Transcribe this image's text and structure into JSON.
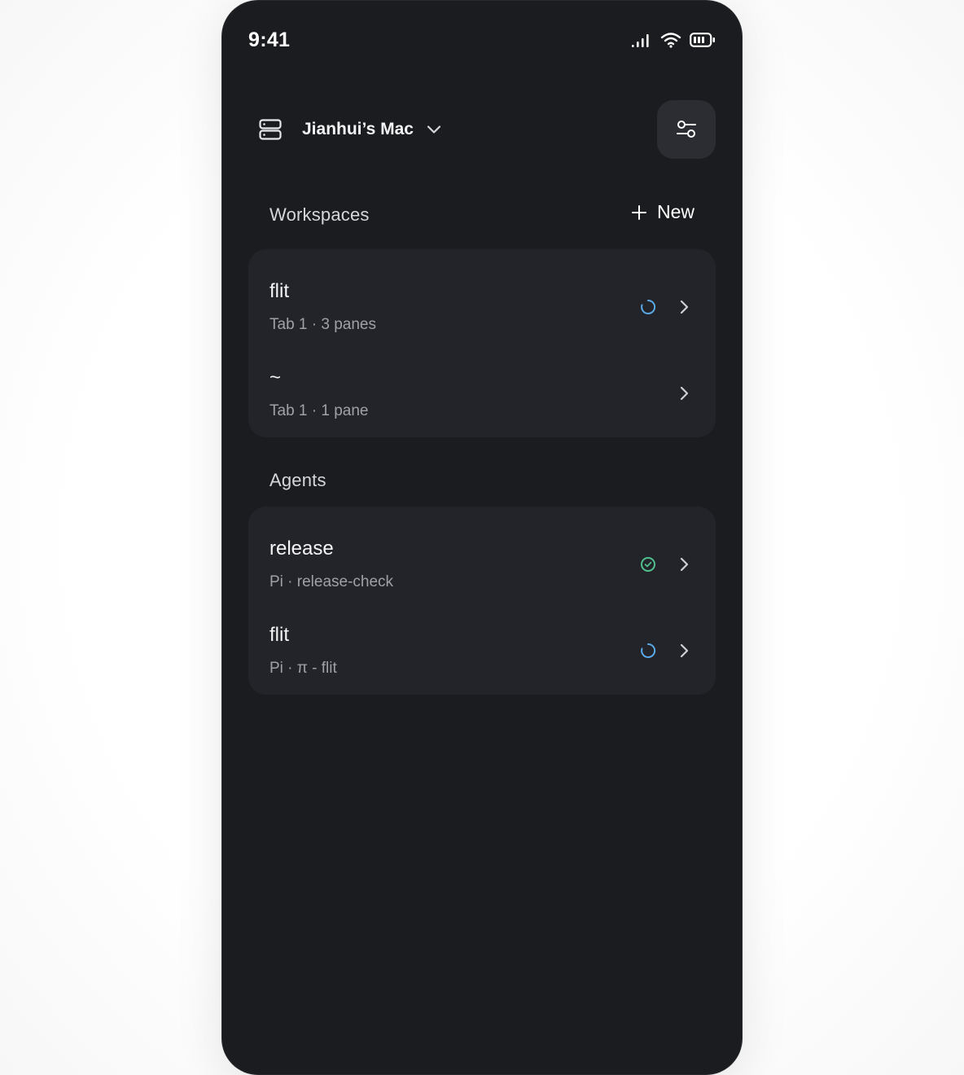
{
  "status_bar": {
    "time": "9:41",
    "icons": [
      "cellular-signal-icon",
      "wifi-icon",
      "battery-icon"
    ]
  },
  "header": {
    "host_icon": "server-icon",
    "host_name": "Jianhui’s Mac",
    "host_dropdown_icon": "chevron-down-icon",
    "settings_icon": "sliders-icon"
  },
  "workspaces": {
    "title": "Workspaces",
    "new_label": "New",
    "items": [
      {
        "title": "flit",
        "subtitle": "Tab 1 · 3 panes",
        "status": "loading"
      },
      {
        "title": "~",
        "subtitle": "Tab 1 · 1 pane",
        "status": "none"
      }
    ]
  },
  "agents": {
    "title": "Agents",
    "items": [
      {
        "title": "release",
        "subtitle": "Pi · release-check",
        "status": "done"
      },
      {
        "title": "flit",
        "subtitle": "Pi · π - flit",
        "status": "loading"
      }
    ]
  },
  "colors": {
    "background": "#1b1c1f",
    "card": "#232429",
    "loading": "#5aa8e6",
    "done": "#4fc08d",
    "muted_text": "#9fa1a8"
  }
}
